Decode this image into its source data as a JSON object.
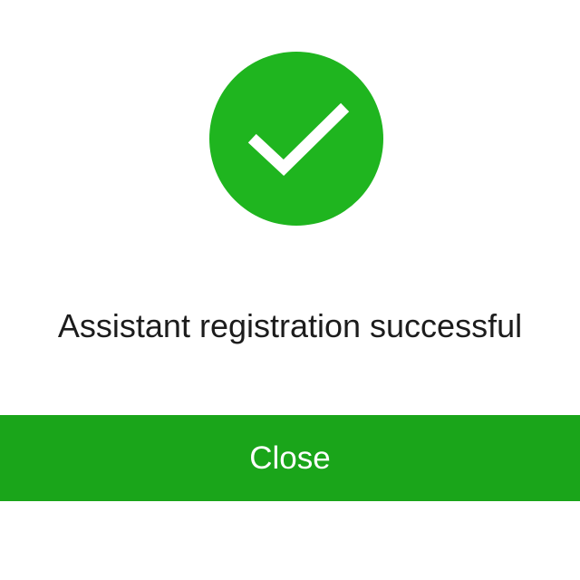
{
  "dialog": {
    "icon": "checkmark-icon",
    "message": "Assistant registration successful",
    "close_label": "Close"
  },
  "colors": {
    "success_circle": "#1fb51f",
    "close_button": "#1aa51a",
    "close_text": "#ffffff",
    "message_text": "#1c1c1c"
  }
}
